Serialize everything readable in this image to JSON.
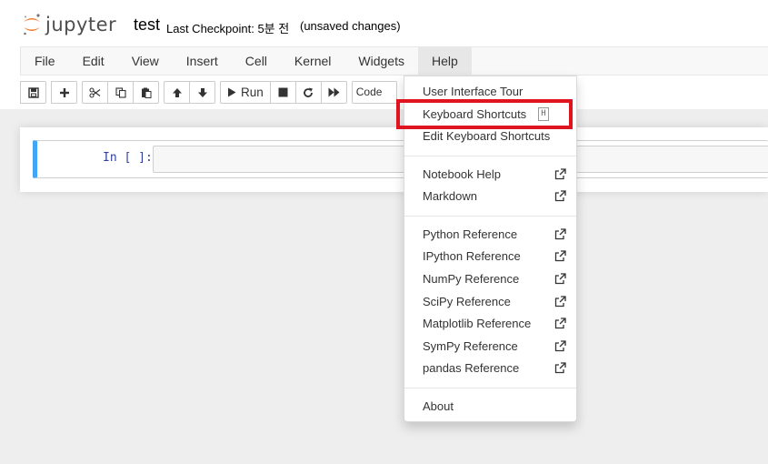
{
  "app": {
    "logo_text": "jupyter",
    "notebook_name": "test",
    "checkpoint": "Last Checkpoint: 5분 전",
    "autosave_status": "(unsaved changes)"
  },
  "menubar": {
    "items": [
      {
        "label": "File"
      },
      {
        "label": "Edit"
      },
      {
        "label": "View"
      },
      {
        "label": "Insert"
      },
      {
        "label": "Cell"
      },
      {
        "label": "Kernel"
      },
      {
        "label": "Widgets"
      },
      {
        "label": "Help"
      }
    ],
    "open_menu": "Help"
  },
  "toolbar": {
    "run_label": "Run",
    "cell_type": "Code"
  },
  "cell": {
    "prompt": "In [ ]:"
  },
  "help_menu": {
    "items": [
      {
        "label": "User Interface Tour"
      },
      {
        "label": "Keyboard Shortcuts",
        "shortcut": "H"
      },
      {
        "label": "Edit Keyboard Shortcuts"
      },
      {
        "label": "Notebook Help"
      },
      {
        "label": "Markdown"
      },
      {
        "label": "Python Reference"
      },
      {
        "label": "IPython Reference"
      },
      {
        "label": "NumPy Reference"
      },
      {
        "label": "SciPy Reference"
      },
      {
        "label": "Matplotlib Reference"
      },
      {
        "label": "SymPy Reference"
      },
      {
        "label": "pandas Reference"
      },
      {
        "label": "About"
      }
    ],
    "highlight_color": "#e0141e"
  },
  "colors": {
    "cell_selected_border": "#42a5f5",
    "prompt_color": "#303f9f",
    "logo_orange": "#f37726"
  }
}
